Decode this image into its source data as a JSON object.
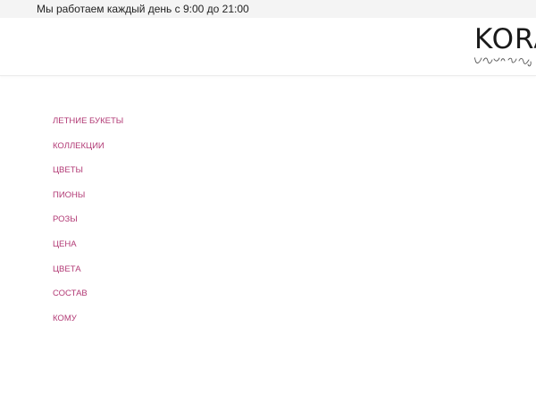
{
  "topbar": {
    "hours_text": "Мы работаем каждый день с 9:00 до 21:00"
  },
  "header": {
    "logo_text": "KORA",
    "logo_icon": "kora-logo-icon"
  },
  "colors": {
    "accent": "#b23a75",
    "topbar_bg": "#f4f4f4",
    "text": "#222222"
  },
  "menu": {
    "items": [
      {
        "label": "ЛЕТНИЕ БУКЕТЫ"
      },
      {
        "label": "КОЛЛЕКЦИИ"
      },
      {
        "label": "ЦВЕТЫ"
      },
      {
        "label": "ПИОНЫ"
      },
      {
        "label": "РОЗЫ"
      },
      {
        "label": "ЦЕНА"
      },
      {
        "label": "ЦВЕТА"
      },
      {
        "label": "СОСТАВ"
      },
      {
        "label": "КОМУ"
      }
    ]
  }
}
